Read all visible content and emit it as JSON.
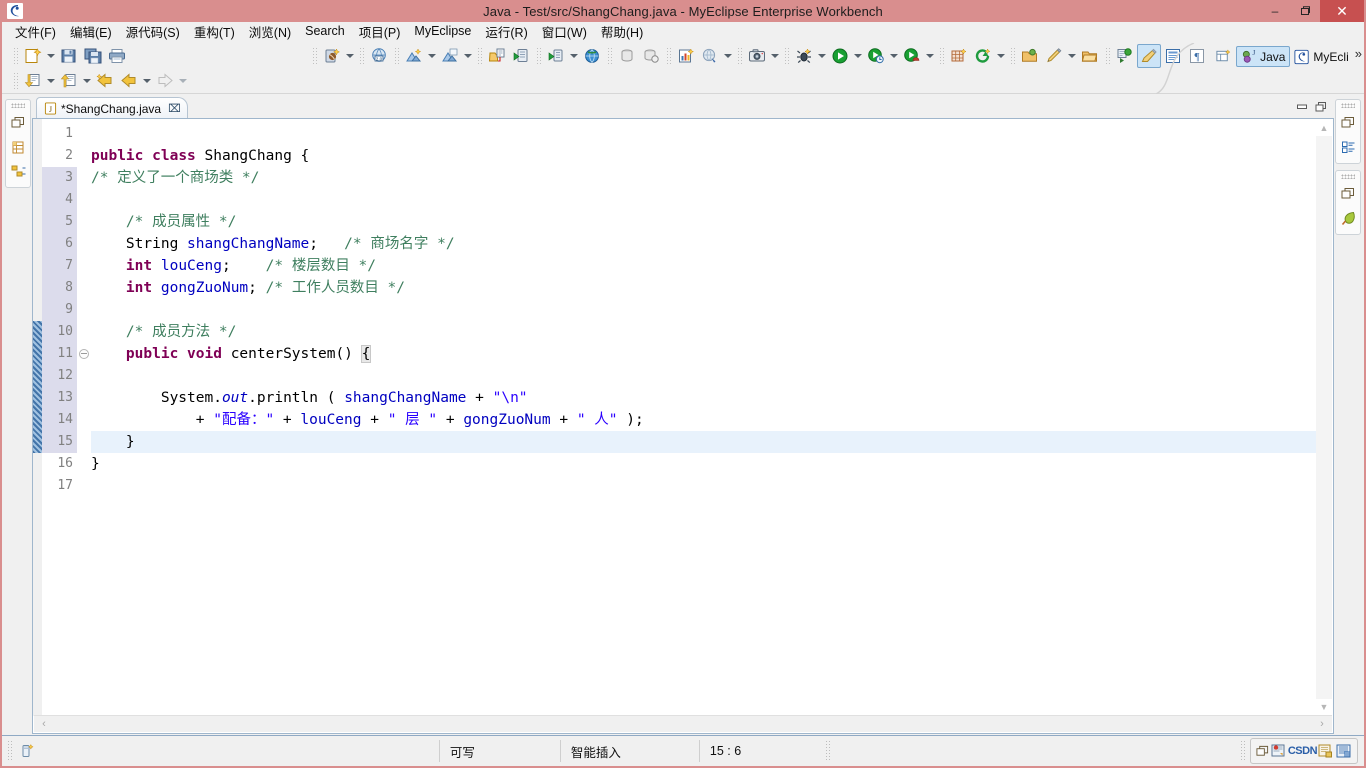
{
  "window": {
    "title": "Java - Test/src/ShangChang.java - MyEclipse Enterprise Workbench",
    "titlebar_color": "#d98e8e",
    "close_color": "#c75050",
    "minimize_label": "–",
    "restore_label": "❐",
    "close_label": "✕",
    "app_icon": "myeclipse-icon"
  },
  "menu": {
    "items": [
      {
        "label": "文件(F)",
        "mnemonic": "F"
      },
      {
        "label": "编辑(E)",
        "mnemonic": "E"
      },
      {
        "label": "源代码(S)",
        "mnemonic": "S"
      },
      {
        "label": "重构(T)",
        "mnemonic": "T"
      },
      {
        "label": "浏览(N)",
        "mnemonic": "N"
      },
      {
        "label": "Search",
        "mnemonic": "a"
      },
      {
        "label": "项目(P)",
        "mnemonic": "P"
      },
      {
        "label": "MyEclipse",
        "mnemonic": ""
      },
      {
        "label": "运行(R)",
        "mnemonic": "R"
      },
      {
        "label": "窗口(W)",
        "mnemonic": "W"
      },
      {
        "label": "帮助(H)",
        "mnemonic": "H"
      }
    ]
  },
  "toolbar": {
    "row1": [
      {
        "icon": "new-wizard-icon",
        "dropdown": true
      },
      {
        "icon": "save-icon",
        "dropdown": false
      },
      {
        "icon": "save-all-icon",
        "dropdown": false
      },
      {
        "icon": "print-icon",
        "dropdown": false
      },
      {
        "icon": "new-java-package-icon",
        "dropdown": true
      },
      {
        "icon": "myeclipse-web20-icon",
        "dropdown": false
      },
      {
        "icon": "new-java-class-icon",
        "dropdown": true
      },
      {
        "icon": "new-java-project-icon",
        "dropdown": true
      },
      {
        "icon": "open-type-icon",
        "dropdown": false
      },
      {
        "icon": "run-server-icon",
        "dropdown": false
      },
      {
        "icon": "deploy-icon",
        "dropdown": true
      },
      {
        "icon": "web-browser-icon",
        "dropdown": false
      },
      {
        "icon": "db-export-icon",
        "dropdown": false
      },
      {
        "icon": "db-import-icon",
        "dropdown": false
      },
      {
        "icon": "report-icon",
        "dropdown": false
      },
      {
        "icon": "globe-config-icon",
        "dropdown": true
      },
      {
        "icon": "snapshot-icon",
        "dropdown": true
      },
      {
        "icon": "debug-icon",
        "dropdown": true
      },
      {
        "icon": "run-icon",
        "dropdown": true
      },
      {
        "icon": "run-history-icon",
        "dropdown": true
      },
      {
        "icon": "run-external-icon",
        "dropdown": true
      },
      {
        "icon": "new-table-icon",
        "dropdown": false
      },
      {
        "icon": "refresh-green-icon",
        "dropdown": true
      },
      {
        "icon": "open-resource-icon",
        "dropdown": false
      },
      {
        "icon": "pencil-icon",
        "dropdown": true
      },
      {
        "icon": "open-folder-icon",
        "dropdown": false
      },
      {
        "icon": "next-annotation-icon",
        "dropdown": false
      },
      {
        "icon": "mark-occurrences-icon",
        "dropdown": false,
        "selected": true
      },
      {
        "icon": "show-whitespace-block-icon",
        "dropdown": false
      },
      {
        "icon": "show-paragraph-icon",
        "dropdown": false
      }
    ],
    "row2": [
      {
        "icon": "back-annotation-icon",
        "dropdown": true
      },
      {
        "icon": "forward-annotation-icon",
        "dropdown": true
      },
      {
        "icon": "last-edit-location-icon",
        "dropdown": false
      },
      {
        "icon": "back-nav-icon",
        "dropdown": true
      },
      {
        "icon": "forward-nav-icon",
        "dropdown": true
      }
    ]
  },
  "perspective": {
    "open_button_icon": "open-perspective-icon",
    "items": [
      {
        "label": "Java",
        "icon": "java-perspective-icon",
        "active": true
      },
      {
        "label": "MyEcli",
        "icon": "myeclipse-perspective-icon",
        "active": false
      }
    ],
    "overflow_label": "»"
  },
  "sidebars": {
    "left": [
      {
        "icons": [
          "restore-view-icon",
          "package-explorer-icon",
          "hierarchy-icon"
        ]
      }
    ],
    "right": [
      {
        "icons": [
          "restore-view-icon",
          "outline-icon"
        ]
      },
      {
        "icons": [
          "restore-view-icon",
          "myeclipse-leaf-icon"
        ]
      }
    ]
  },
  "editor": {
    "tab": {
      "title": "*ShangChang.java",
      "dirty": true,
      "file_icon": "java-file-icon",
      "close_label": "⌧"
    },
    "tab_buttons": [
      {
        "icon": "minimize-icon"
      },
      {
        "icon": "maximize-icon"
      }
    ],
    "cursor_line": 15,
    "current_line_highlight": 15,
    "gutter_selected_range": [
      3,
      15
    ],
    "annotation_range": [
      10,
      15
    ],
    "folding_marker_line": 11,
    "scroll": {
      "up_arrow": "▲",
      "down_arrow": "▼",
      "left_arrow": "‹",
      "right_arrow": "›"
    },
    "lines": [
      {
        "n": 1,
        "tokens": []
      },
      {
        "n": 2,
        "tokens": [
          {
            "t": "public",
            "c": "kw"
          },
          {
            "t": " ",
            "c": "pl"
          },
          {
            "t": "class",
            "c": "kw"
          },
          {
            "t": " ShangChang {",
            "c": "pl"
          }
        ]
      },
      {
        "n": 3,
        "tokens": [
          {
            "t": "/* 定义了一个商场类 */",
            "c": "cmt"
          }
        ]
      },
      {
        "n": 4,
        "tokens": []
      },
      {
        "n": 5,
        "tokens": [
          {
            "t": "    /* 成员属性 */",
            "c": "cmt"
          }
        ]
      },
      {
        "n": 6,
        "tokens": [
          {
            "t": "    String ",
            "c": "pl"
          },
          {
            "t": "shangChangName",
            "c": "fld"
          },
          {
            "t": ";   ",
            "c": "pl"
          },
          {
            "t": "/* 商场名字 */",
            "c": "cmt"
          }
        ]
      },
      {
        "n": 7,
        "tokens": [
          {
            "t": "    ",
            "c": "pl"
          },
          {
            "t": "int",
            "c": "kw"
          },
          {
            "t": " ",
            "c": "pl"
          },
          {
            "t": "louCeng",
            "c": "fld"
          },
          {
            "t": ";    ",
            "c": "pl"
          },
          {
            "t": "/* 楼层数目 */",
            "c": "cmt"
          }
        ]
      },
      {
        "n": 8,
        "tokens": [
          {
            "t": "    ",
            "c": "pl"
          },
          {
            "t": "int",
            "c": "kw"
          },
          {
            "t": " ",
            "c": "pl"
          },
          {
            "t": "gongZuoNum",
            "c": "fld"
          },
          {
            "t": "; ",
            "c": "pl"
          },
          {
            "t": "/* 工作人员数目 */",
            "c": "cmt"
          }
        ]
      },
      {
        "n": 9,
        "tokens": []
      },
      {
        "n": 10,
        "tokens": [
          {
            "t": "    /* 成员方法 */",
            "c": "cmt"
          }
        ]
      },
      {
        "n": 11,
        "tokens": [
          {
            "t": "    ",
            "c": "pl"
          },
          {
            "t": "public",
            "c": "kw"
          },
          {
            "t": " ",
            "c": "pl"
          },
          {
            "t": "void",
            "c": "kw"
          },
          {
            "t": " centerSystem() ",
            "c": "pl"
          },
          {
            "t": "{",
            "c": "brk"
          }
        ]
      },
      {
        "n": 12,
        "tokens": []
      },
      {
        "n": 13,
        "tokens": [
          {
            "t": "        System.",
            "c": "pl"
          },
          {
            "t": "out",
            "c": "sfld"
          },
          {
            "t": ".println ( ",
            "c": "pl"
          },
          {
            "t": "shangChangName",
            "c": "fld"
          },
          {
            "t": " + ",
            "c": "pl"
          },
          {
            "t": "\"\\n\"",
            "c": "str"
          }
        ]
      },
      {
        "n": 14,
        "tokens": [
          {
            "t": "            + ",
            "c": "pl"
          },
          {
            "t": "\"配备：\"",
            "c": "str"
          },
          {
            "t": " + ",
            "c": "pl"
          },
          {
            "t": "louCeng",
            "c": "fld"
          },
          {
            "t": " + ",
            "c": "pl"
          },
          {
            "t": "\" 层 \"",
            "c": "str"
          },
          {
            "t": " + ",
            "c": "pl"
          },
          {
            "t": "gongZuoNum",
            "c": "fld"
          },
          {
            "t": " + ",
            "c": "pl"
          },
          {
            "t": "\" 人\"",
            "c": "str"
          },
          {
            "t": " );",
            "c": "pl"
          }
        ]
      },
      {
        "n": 15,
        "tokens": [
          {
            "t": "    }",
            "c": "pl"
          }
        ]
      },
      {
        "n": 16,
        "tokens": [
          {
            "t": "}",
            "c": "pl"
          }
        ]
      },
      {
        "n": 17,
        "tokens": []
      }
    ]
  },
  "statusbar": {
    "left_icon": "editor-state-icon",
    "cells": [
      {
        "label": "可写"
      },
      {
        "label": "智能插入"
      },
      {
        "label": "15 : 6"
      }
    ],
    "watermark": {
      "icons": [
        "window-tile-icon",
        "csdn-badge-icon",
        "blog-badge-icon",
        "weixin-badge-icon"
      ],
      "text": "CSDN"
    }
  },
  "colors": {
    "keyword": "#7f0055",
    "comment": "#3f7f5f",
    "string": "#2a00ff",
    "field": "#0000c0",
    "selection": "#dcdcec",
    "current_line": "#e8f2fc",
    "accent": "#cce4f7"
  }
}
